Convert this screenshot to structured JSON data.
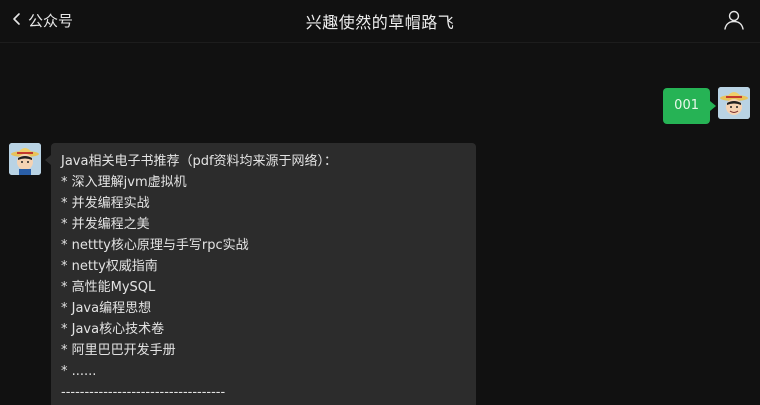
{
  "header": {
    "back_label": "公众号",
    "title": "兴趣使然的草帽路飞"
  },
  "icons": {
    "back": "chevron-left-icon",
    "profile": "user-icon",
    "avatar": "straw-hat-avatar"
  },
  "colors": {
    "background": "#111111",
    "sent_bubble": "#26b355",
    "received_bubble": "#2c2c2c"
  },
  "messages": {
    "sent": {
      "text": "001"
    },
    "received": {
      "lines": [
        "Java相关电子书推荐（pdf资料均来源于网络）：",
        "* 深入理解jvm虚拟机",
        "* 并发编程实战",
        "* 并发编程之美",
        "* nettty核心原理与手写rpc实战",
        "* netty权威指南",
        "* 高性能MySQL",
        "* Java编程思想",
        "* Java核心技术卷",
        "* 阿里巴巴开发手册",
        "* ......",
        "-----------------------------------"
      ]
    }
  }
}
